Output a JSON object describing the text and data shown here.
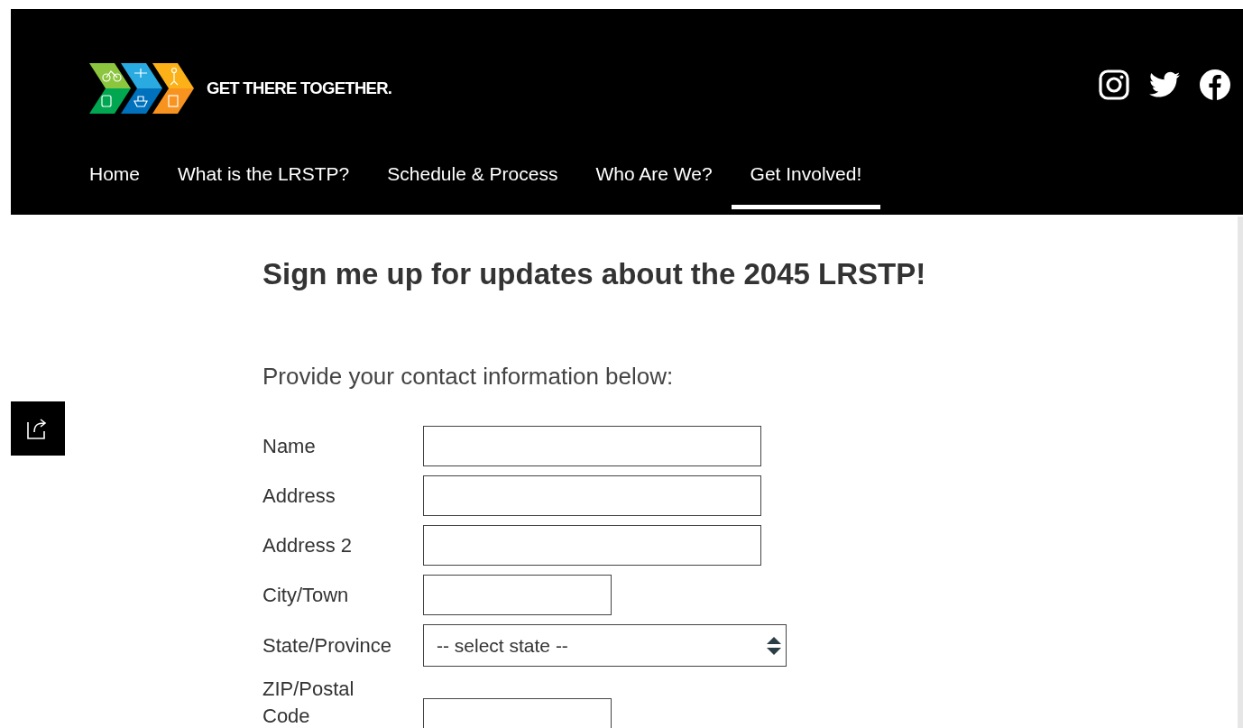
{
  "header": {
    "tagline": "GET THERE TOGETHER.",
    "nav": [
      {
        "label": "Home",
        "selected": false
      },
      {
        "label": "What is the LRSTP?",
        "selected": false
      },
      {
        "label": "Schedule & Process",
        "selected": false
      },
      {
        "label": "Who Are We?",
        "selected": false
      },
      {
        "label": "Get Involved!",
        "selected": true
      }
    ]
  },
  "heading": "Sign me up for updates about the 2045 LRSTP!",
  "intro": "Provide your contact information below:",
  "fields": [
    {
      "label": "Name",
      "kind": "wide"
    },
    {
      "label": "Address",
      "kind": "wide"
    },
    {
      "label": "Address 2",
      "kind": "wide"
    },
    {
      "label": "City/Town",
      "kind": "narrow"
    },
    {
      "label": "State/Province",
      "kind": "select",
      "placeholder": "-- select state --"
    },
    {
      "label": "ZIP/Postal Code",
      "kind": "narrow"
    }
  ]
}
